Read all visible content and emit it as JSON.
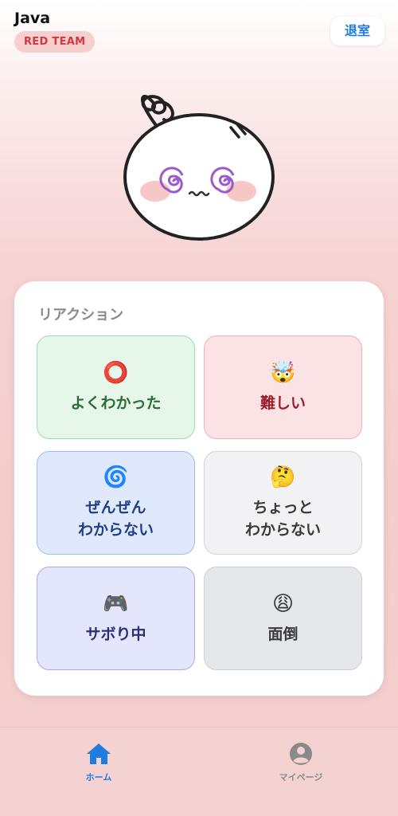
{
  "header": {
    "course_title": "Java",
    "team_badge": "RED TEAM",
    "leave_label": "退室"
  },
  "mascot": {
    "icon": "dizzy-mascot-icon"
  },
  "reactions": {
    "title": "リアクション",
    "items": [
      {
        "emoji": "⭕",
        "label": "よくわかった"
      },
      {
        "emoji": "🤯",
        "label": "難しい"
      },
      {
        "emoji": "🌀",
        "label": "ぜんぜん\nわからない"
      },
      {
        "emoji": "🤔",
        "label": "ちょっと\nわからない"
      },
      {
        "emoji": "🎮",
        "label": "サボり中"
      },
      {
        "emoji": "😩",
        "label": "面倒"
      }
    ]
  },
  "tabbar": {
    "home_label": "ホーム",
    "mypage_label": "マイページ",
    "active_color": "#1e7be0",
    "inactive_color": "#8a8a8a"
  },
  "colors": {
    "team_red": "#d0393f",
    "accent_blue": "#1e7be0"
  }
}
